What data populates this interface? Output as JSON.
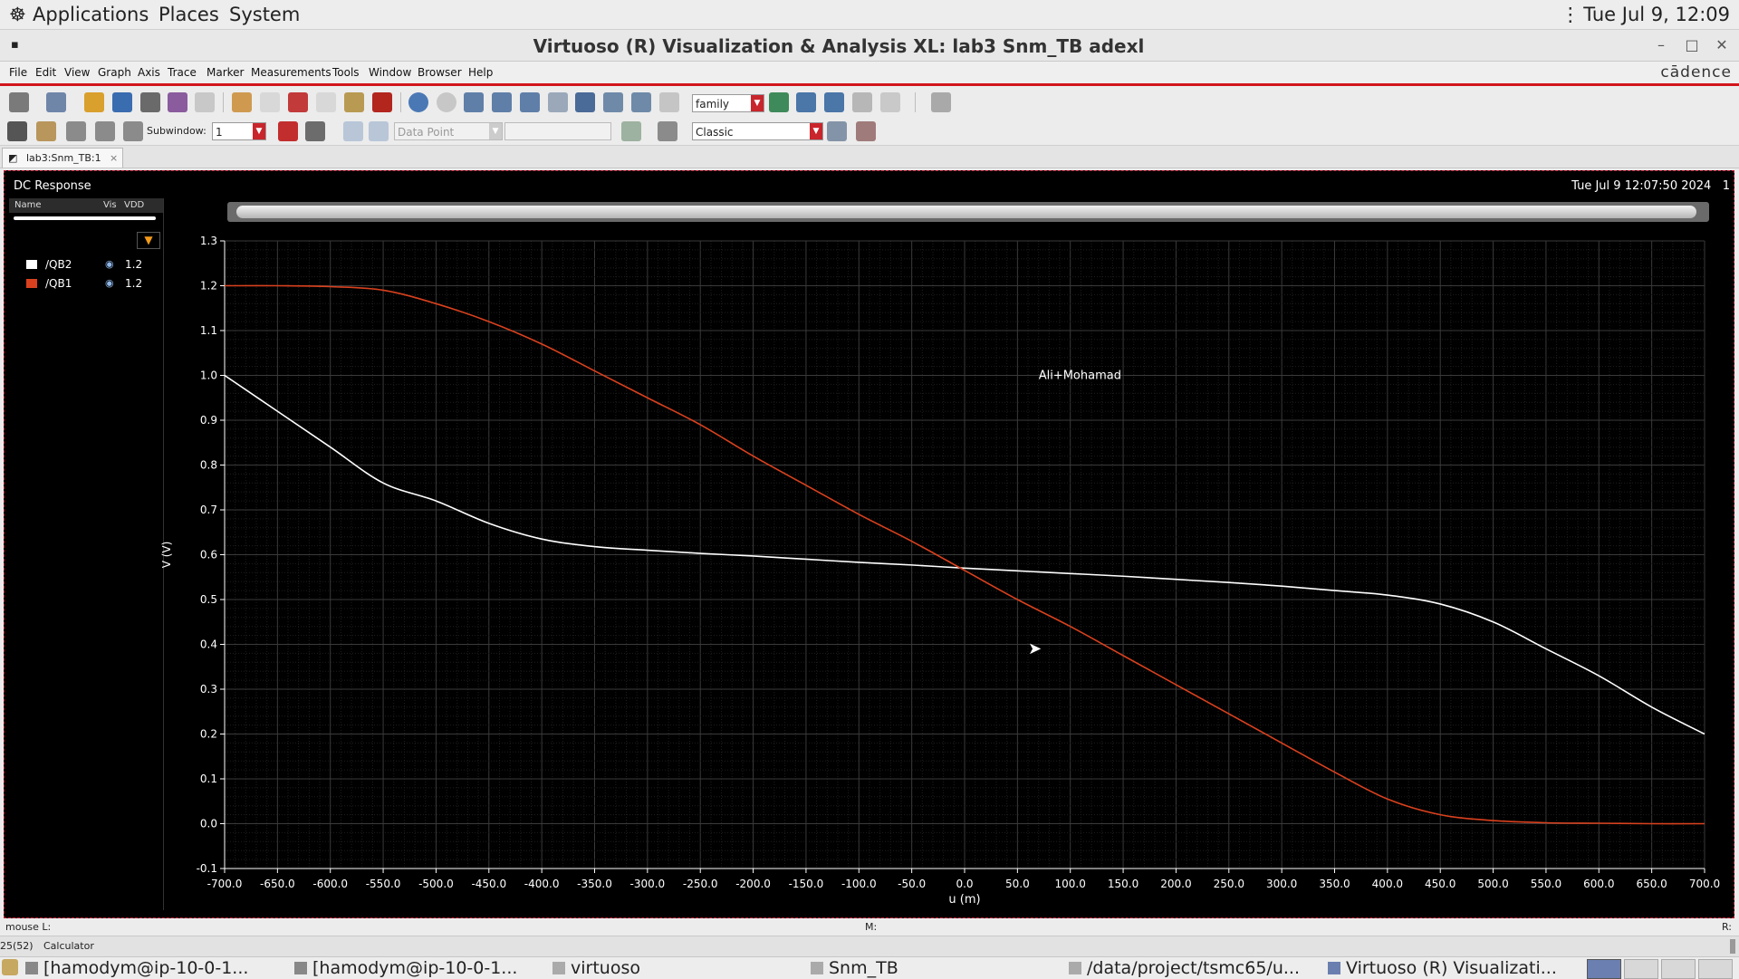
{
  "top_panel": {
    "menus": [
      "Applications",
      "Places",
      "System"
    ],
    "clock": "Tue Jul  9, 12:09"
  },
  "window": {
    "title": "Virtuoso (R) Visualization & Analysis XL: lab3 Snm_TB adexl",
    "brand": "cādence"
  },
  "menubar": [
    "File",
    "Edit",
    "View",
    "Graph",
    "Axis",
    "Trace",
    "Marker",
    "Measurements",
    "Tools",
    "Window",
    "Browser",
    "Help"
  ],
  "toolbar": {
    "plot_style_value": "family",
    "subwindow_label": "Subwindow:",
    "subwindow_value": "1",
    "marker_type_value": "Data Point",
    "theme_value": "Classic"
  },
  "tab": {
    "label": "lab3:Snm_TB:1",
    "close": "×"
  },
  "plot": {
    "panel_title": "DC Response",
    "datetime": "Tue Jul 9 12:07:50 2024",
    "corner_number": "1",
    "annotation": "Ali+Mohamad",
    "legend": {
      "headers": [
        "Name",
        "Vis",
        "VDD"
      ],
      "rows": [
        {
          "name": "/QB2",
          "vdd": "1.2",
          "color": "#ffffff"
        },
        {
          "name": "/QB1",
          "vdd": "1.2",
          "color": "#d9411e"
        }
      ]
    }
  },
  "chart_data": {
    "type": "line",
    "xlabel": "u (m)",
    "ylabel": "V (V)",
    "xlim": [
      -700,
      700
    ],
    "ylim": [
      -0.1,
      1.3
    ],
    "grid": true,
    "xticks": [
      -700,
      -650,
      -600,
      -550,
      -500,
      -450,
      -400,
      -350,
      -300,
      -250,
      -200,
      -150,
      -100,
      -50,
      0,
      50,
      100,
      150,
      200,
      250,
      300,
      350,
      400,
      450,
      500,
      550,
      600,
      650,
      700
    ],
    "yticks": [
      -0.1,
      0.0,
      0.1,
      0.2,
      0.3,
      0.4,
      0.5,
      0.6,
      0.7,
      0.8,
      0.9,
      1.0,
      1.1,
      1.2,
      1.3
    ],
    "series": [
      {
        "name": "/QB2",
        "color": "#ffffff",
        "x": [
          -700,
          -650,
          -600,
          -550,
          -500,
          -450,
          -400,
          -350,
          -300,
          -250,
          -200,
          -150,
          -100,
          -50,
          0,
          50,
          100,
          150,
          200,
          250,
          300,
          350,
          400,
          450,
          500,
          550,
          600,
          650,
          700
        ],
        "y": [
          1.0,
          0.92,
          0.84,
          0.76,
          0.72,
          0.67,
          0.635,
          0.618,
          0.61,
          0.603,
          0.597,
          0.59,
          0.583,
          0.577,
          0.57,
          0.564,
          0.558,
          0.552,
          0.545,
          0.538,
          0.53,
          0.52,
          0.51,
          0.49,
          0.45,
          0.39,
          0.33,
          0.26,
          0.2
        ]
      },
      {
        "name": "/QB1",
        "color": "#d9411e",
        "x": [
          -700,
          -650,
          -600,
          -550,
          -500,
          -450,
          -400,
          -350,
          -300,
          -250,
          -200,
          -150,
          -100,
          -50,
          0,
          50,
          100,
          150,
          200,
          250,
          300,
          350,
          400,
          450,
          500,
          550,
          600,
          650,
          700
        ],
        "y": [
          1.2,
          1.2,
          1.198,
          1.19,
          1.16,
          1.12,
          1.07,
          1.01,
          0.95,
          0.89,
          0.82,
          0.755,
          0.69,
          0.63,
          0.565,
          0.5,
          0.44,
          0.375,
          0.31,
          0.245,
          0.18,
          0.115,
          0.055,
          0.02,
          0.007,
          0.002,
          0.001,
          0.0,
          0.0
        ]
      }
    ]
  },
  "status": {
    "mouse_label": "mouse L:",
    "mid_label": "M:",
    "right_label": "R:",
    "counter": "25(52)",
    "calculator": "Calculator"
  },
  "taskbar": [
    "[hamodym@ip-10-0-1...",
    "[hamodym@ip-10-0-1...",
    "virtuoso",
    "Snm_TB",
    "/data/project/tsmc65/u...",
    "Virtuoso (R) Visualizati..."
  ]
}
